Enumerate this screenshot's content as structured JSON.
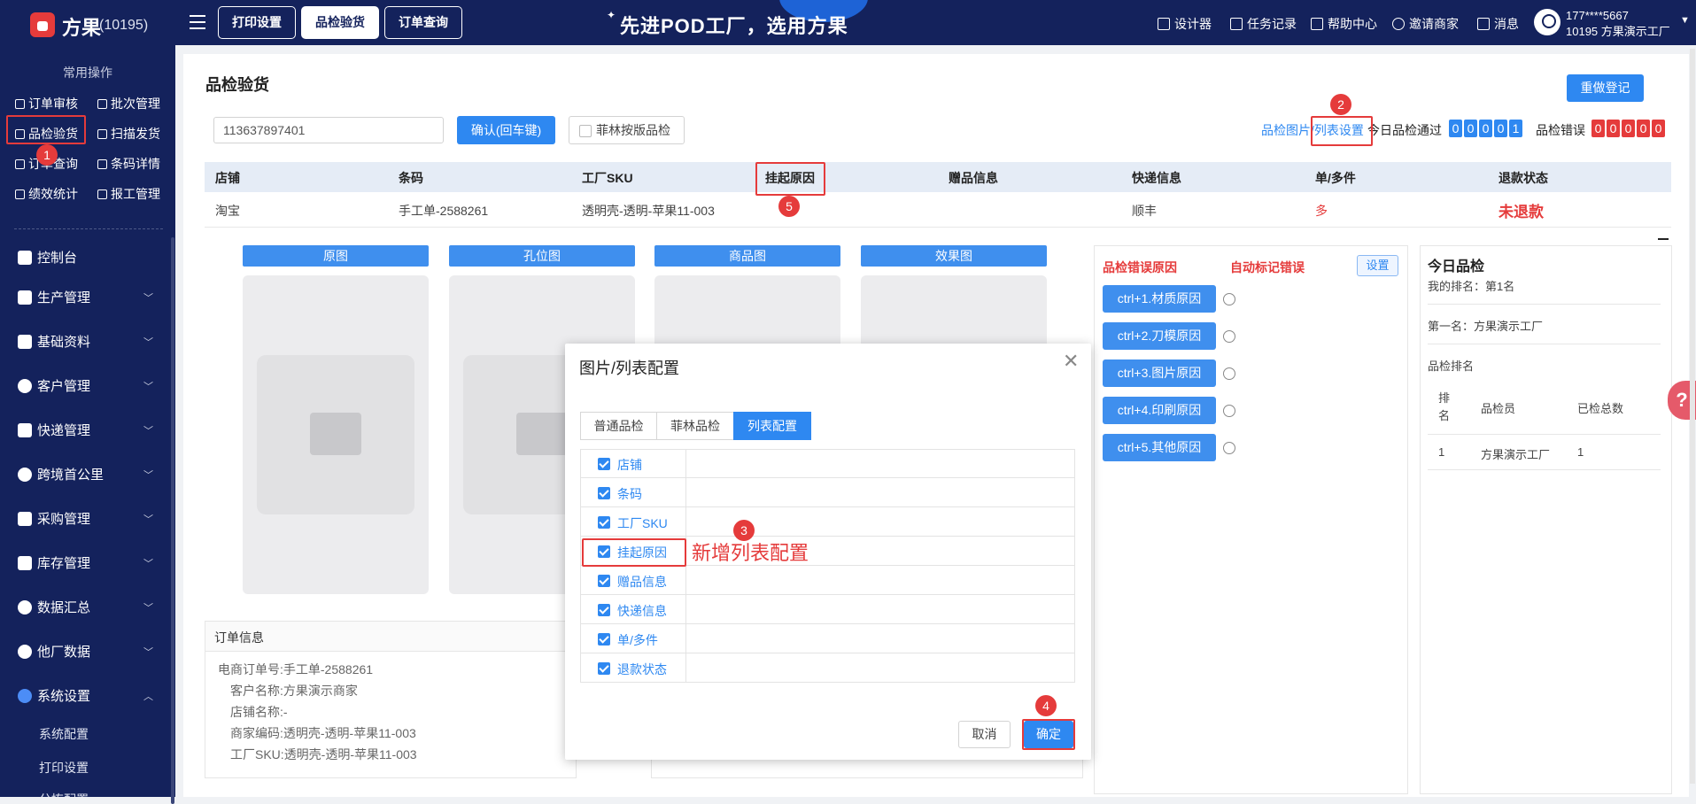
{
  "header": {
    "brand": "方果",
    "brand_id": "(10195)",
    "tabs": [
      "打印设置",
      "品检验货",
      "订单查询"
    ],
    "slogan": "先进POD工厂，选用方果",
    "items": [
      "设计器",
      "任务记录",
      "帮助中心",
      "邀请商家",
      "消息"
    ],
    "user_phone": "177****5667",
    "user_name": "10195 方果演示工厂"
  },
  "sidebar": {
    "common_title": "常用操作",
    "quick_ops": [
      "订单审核",
      "批次管理",
      "品检验货",
      "扫描发货",
      "订单查询",
      "条码详情",
      "绩效统计",
      "报工管理"
    ],
    "nav": [
      "控制台",
      "生产管理",
      "基础资料",
      "客户管理",
      "快递管理",
      "跨境首公里",
      "采购管理",
      "库存管理",
      "数据汇总",
      "他厂数据",
      "系统设置"
    ],
    "subnav": [
      "系统配置",
      "打印设置",
      "分拣配置"
    ]
  },
  "page": {
    "title": "品检验货",
    "redo_button": "重做登记",
    "barcode_value": "113637897401",
    "confirm_button": "确认(回车键)",
    "non_forest_check": "菲林按版品检",
    "link_images": "品检图片",
    "link_sep": "/",
    "link_list": "列表设置",
    "today_pass_label": "今日品检通过",
    "today_pass_digits": [
      "0",
      "0",
      "0",
      "0",
      "1"
    ],
    "error_label": "品检错误",
    "error_digits": [
      "0",
      "0",
      "0",
      "0",
      "0"
    ]
  },
  "table": {
    "headers": [
      "店铺",
      "条码",
      "工厂SKU",
      "挂起原因",
      "赠品信息",
      "快递信息",
      "单/多件",
      "退款状态"
    ],
    "row": [
      "淘宝",
      "手工单-2588261",
      "透明壳-透明-苹果11-003",
      "",
      "",
      "顺丰",
      "多",
      "未退款"
    ]
  },
  "image_tabs": [
    "原图",
    "孔位图",
    "商品图",
    "效果图"
  ],
  "order_info": {
    "title": "订单信息",
    "rows": [
      {
        "label": "电商订单号:",
        "value": "手工单-2588261"
      },
      {
        "label": "客户名称:",
        "value": "方果演示商家"
      },
      {
        "label": "店铺名称:",
        "value": "-"
      },
      {
        "label": "商家编码:",
        "value": "透明壳-透明-苹果11-003"
      },
      {
        "label": "工厂SKU:",
        "value": "透明壳-透明-苹果11-003"
      }
    ]
  },
  "error_panel": {
    "tab_reason": "品检错误原因",
    "tab_auto": "自动标记错误",
    "settings_button": "设置",
    "reasons": [
      "ctrl+1.材质原因",
      "ctrl+2.刀模原因",
      "ctrl+3.图片原因",
      "ctrl+4.印刷原因",
      "ctrl+5.其他原因"
    ]
  },
  "ranking": {
    "title": "今日品检",
    "my_rank": "我的排名：第1名",
    "first": "第一名：方果演示工厂",
    "section": "品检排名",
    "col_rank": "排名",
    "col_inspector": "品检员",
    "col_total": "已检总数",
    "row": {
      "rank": "1",
      "inspector": "方果演示工厂",
      "total": "1"
    }
  },
  "modal": {
    "title": "图片/列表配置",
    "tabs": [
      "普通品检",
      "菲林品检",
      "列表配置"
    ],
    "columns": [
      "店铺",
      "条码",
      "工厂SKU",
      "挂起原因",
      "赠品信息",
      "快递信息",
      "单/多件",
      "退款状态"
    ],
    "cancel": "取消",
    "ok": "确定"
  },
  "annotations": {
    "note": "新增列表配置",
    "badges": [
      "1",
      "2",
      "3",
      "4",
      "5"
    ]
  },
  "colors": {
    "sidebar_bg": "#14225c",
    "accent": "#2e88f1",
    "annotation_red": "#e53b3b"
  }
}
